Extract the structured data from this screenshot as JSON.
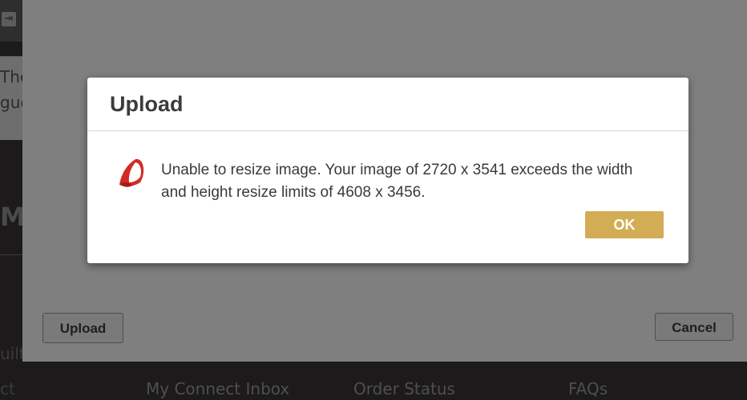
{
  "background": {
    "text_line_1": "The",
    "text_line_2": "gue",
    "menu_fragment": "ME",
    "left_fragment_1": "uilts",
    "left_fragment_2": "ct",
    "footer_links": [
      "My Connect Inbox",
      "Order Status",
      "FAQs"
    ]
  },
  "upload_dialog": {
    "upload_button_label": "Upload",
    "cancel_button_label": "Cancel"
  },
  "alert": {
    "title": "Upload",
    "message": "Unable to resize image. Your image of 2720 x 3541 exceeds the width and height resize limits of 4608 x 3456.",
    "ok_label": "OK",
    "icon": "error-icon",
    "accent_color": "#d3ad55"
  }
}
